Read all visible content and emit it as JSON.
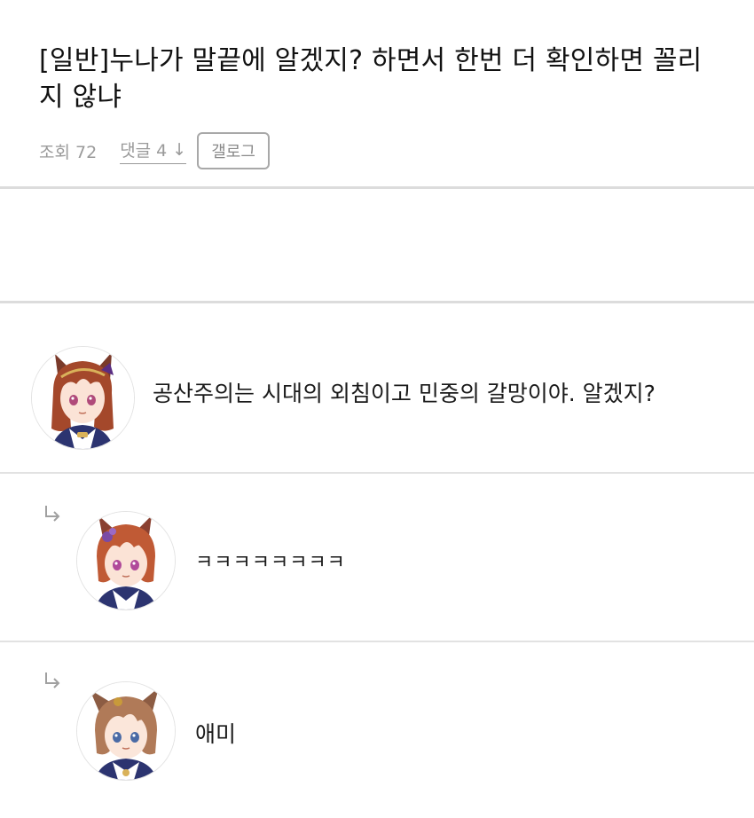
{
  "post": {
    "title": "[일반]누나가 말끝에 알겠지? 하면서 한번 더 확인하면 꼴리지 않냐",
    "views_label": "조회 72",
    "comments_label": "댓글 4",
    "comments_arrow": "↓",
    "gallog_label": "갤로그"
  },
  "comments": [
    {
      "text": "공산주의는 시대의 외침이고 민중의 갈망이야. 알겠지?",
      "is_reply": false,
      "avatar": "avatar-red-hair-horse-girl",
      "colors": {
        "hair": "#a4482b",
        "ears": "#7a3a2a",
        "accent": "#5a2d82"
      }
    },
    {
      "text": "ㅋㅋㅋㅋㅋㅋㅋㅋ",
      "is_reply": true,
      "avatar": "avatar-short-orange-hair-horse-girl",
      "colors": {
        "hair": "#c05a35",
        "ears": "#8a4030",
        "accent": "#7b4aa5"
      }
    },
    {
      "text": "애미",
      "is_reply": true,
      "avatar": "avatar-light-brown-hair-horse-girl",
      "colors": {
        "hair": "#b07a58",
        "ears": "#8c5c43",
        "accent": "#c89a3a"
      }
    }
  ],
  "icons": {
    "reply": "reply-arrow-icon"
  },
  "theme": {
    "divider": "#dcdcdc",
    "meta_text": "#9a9a9a",
    "uniform_navy": "#2c3470"
  }
}
